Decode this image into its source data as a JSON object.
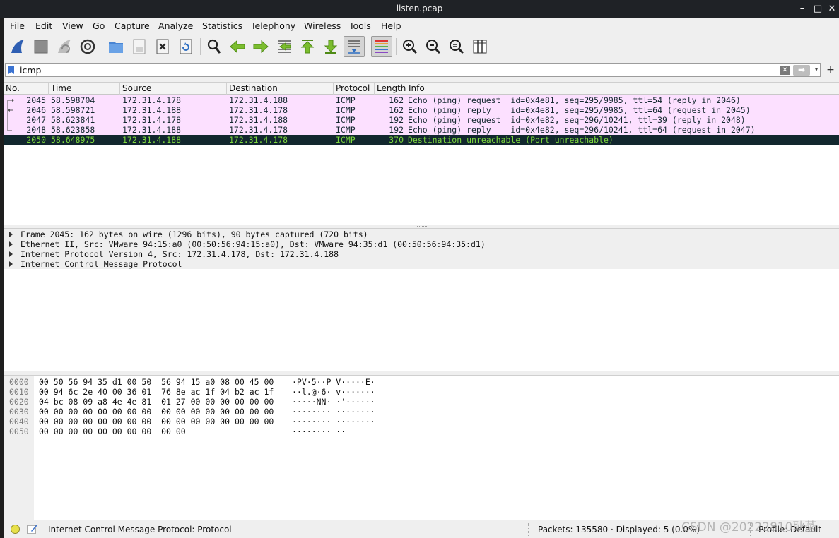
{
  "window": {
    "title": "listen.pcap"
  },
  "menu": [
    {
      "pre": "",
      "u": "F",
      "post": "ile"
    },
    {
      "pre": "",
      "u": "E",
      "post": "dit"
    },
    {
      "pre": "",
      "u": "V",
      "post": "iew"
    },
    {
      "pre": "",
      "u": "G",
      "post": "o"
    },
    {
      "pre": "",
      "u": "C",
      "post": "apture"
    },
    {
      "pre": "",
      "u": "A",
      "post": "nalyze"
    },
    {
      "pre": "",
      "u": "S",
      "post": "tatistics"
    },
    {
      "pre": "Telephon",
      "u": "y",
      "post": ""
    },
    {
      "pre": "",
      "u": "W",
      "post": "ireless"
    },
    {
      "pre": "",
      "u": "T",
      "post": "ools"
    },
    {
      "pre": "",
      "u": "H",
      "post": "elp"
    }
  ],
  "toolbar": {
    "icons": [
      "shark-fin-start-icon",
      "stop-capture-icon",
      "restart-capture-icon",
      "capture-options-icon",
      "open-file-icon",
      "save-file-icon",
      "close-file-icon",
      "reload-file-icon",
      "find-packet-icon",
      "go-back-icon",
      "go-forward-icon",
      "go-to-packet-icon",
      "first-packet-icon",
      "last-packet-icon",
      "auto-scroll-icon",
      "colorize-icon",
      "zoom-in-icon",
      "zoom-out-icon",
      "normal-size-icon",
      "resize-columns-icon"
    ]
  },
  "filter": {
    "value": "icmp",
    "clear": "✕",
    "apply": "➡",
    "dropdown": "▾",
    "add": "+"
  },
  "columns": [
    "No.",
    "Time",
    "Source",
    "Destination",
    "Protocol",
    "Length",
    "Info"
  ],
  "packets": [
    {
      "no": "2045",
      "time": "58.598704",
      "src": "172.31.4.178",
      "dst": "172.31.4.188",
      "proto": "ICMP",
      "len": "162",
      "info": "Echo (ping) request  id=0x4e81, seq=295/9985, ttl=54 (reply in 2046)"
    },
    {
      "no": "2046",
      "time": "58.598721",
      "src": "172.31.4.188",
      "dst": "172.31.4.178",
      "proto": "ICMP",
      "len": "162",
      "info": "Echo (ping) reply    id=0x4e81, seq=295/9985, ttl=64 (request in 2045)"
    },
    {
      "no": "2047",
      "time": "58.623841",
      "src": "172.31.4.178",
      "dst": "172.31.4.188",
      "proto": "ICMP",
      "len": "192",
      "info": "Echo (ping) request  id=0x4e82, seq=296/10241, ttl=39 (reply in 2048)"
    },
    {
      "no": "2048",
      "time": "58.623858",
      "src": "172.31.4.188",
      "dst": "172.31.4.178",
      "proto": "ICMP",
      "len": "192",
      "info": "Echo (ping) reply    id=0x4e82, seq=296/10241, ttl=64 (request in 2047)"
    },
    {
      "no": "2050",
      "time": "58.648975",
      "src": "172.31.4.188",
      "dst": "172.31.4.178",
      "proto": "ICMP",
      "len": "370",
      "info": "Destination unreachable (Port unreachable)"
    }
  ],
  "details": [
    "Frame 2045: 162 bytes on wire (1296 bits), 90 bytes captured (720 bits)",
    "Ethernet II, Src: VMware_94:15:a0 (00:50:56:94:15:a0), Dst: VMware_94:35:d1 (00:50:56:94:35:d1)",
    "Internet Protocol Version 4, Src: 172.31.4.178, Dst: 172.31.4.188",
    "Internet Control Message Protocol"
  ],
  "bytes": [
    {
      "off": "0000",
      "hex": "00 50 56 94 35 d1 00 50  56 94 15 a0 08 00 45 00",
      "ascii": "·PV·5··P V·····E·"
    },
    {
      "off": "0010",
      "hex": "00 94 6c 2e 40 00 36 01  76 8e ac 1f 04 b2 ac 1f",
      "ascii": "··l.@·6· v·······"
    },
    {
      "off": "0020",
      "hex": "04 bc 08 09 a8 4e 4e 81  01 27 00 00 00 00 00 00",
      "ascii": "·····NN· ·'······"
    },
    {
      "off": "0030",
      "hex": "00 00 00 00 00 00 00 00  00 00 00 00 00 00 00 00",
      "ascii": "········ ········"
    },
    {
      "off": "0040",
      "hex": "00 00 00 00 00 00 00 00  00 00 00 00 00 00 00 00",
      "ascii": "········ ········"
    },
    {
      "off": "0050",
      "hex": "00 00 00 00 00 00 00 00  00 00",
      "ascii": "········ ··"
    }
  ],
  "status": {
    "message": "Internet Control Message Protocol: Protocol",
    "packets": "Packets: 135580 · Displayed: 5 (0.0%)",
    "profile": "Profile: Default"
  },
  "watermark": "CSDN @20222810耿菡",
  "colors": {
    "row_bg": "#fce0ff",
    "row_text": "#12272e",
    "selected_bg": "#12272e",
    "selected_text": "#f78787",
    "selected_accent": "#7fd93f"
  }
}
